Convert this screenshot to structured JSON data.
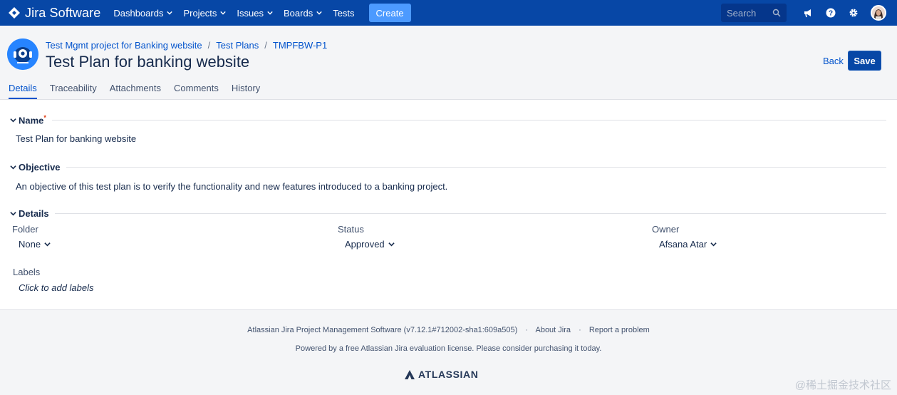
{
  "app": {
    "name": "Jira Software"
  },
  "nav": {
    "items": [
      {
        "label": "Dashboards",
        "has_menu": true
      },
      {
        "label": "Projects",
        "has_menu": true
      },
      {
        "label": "Issues",
        "has_menu": true
      },
      {
        "label": "Boards",
        "has_menu": true
      },
      {
        "label": "Tests",
        "has_menu": false
      }
    ],
    "create_label": "Create",
    "search_placeholder": "Search"
  },
  "header": {
    "breadcrumb": [
      "Test Mgmt project for Banking website",
      "Test Plans",
      "TMPFBW-P1"
    ],
    "title": "Test Plan for banking website",
    "back_label": "Back",
    "save_label": "Save"
  },
  "tabs": [
    {
      "label": "Details",
      "active": true
    },
    {
      "label": "Traceability",
      "active": false
    },
    {
      "label": "Attachments",
      "active": false
    },
    {
      "label": "Comments",
      "active": false
    },
    {
      "label": "History",
      "active": false
    }
  ],
  "sections": {
    "name": {
      "label": "Name",
      "required_mark": "*",
      "value": "Test Plan for banking website"
    },
    "objective": {
      "label": "Objective",
      "value": "An objective of this test plan is to verify the functionality and new features introduced to a banking project."
    },
    "details": {
      "label": "Details",
      "folder": {
        "label": "Folder",
        "value": "None"
      },
      "status": {
        "label": "Status",
        "value": "Approved"
      },
      "owner": {
        "label": "Owner",
        "value": "Afsana Atar"
      },
      "labels": {
        "label": "Labels",
        "placeholder": "Click to add labels"
      }
    }
  },
  "footer": {
    "version_text": "Atlassian Jira Project Management Software (v7.12.1#712002-sha1:609a505)",
    "about_label": "About Jira",
    "report_label": "Report a problem",
    "license_text": "Powered by a free Atlassian Jira evaluation license. Please consider purchasing it today.",
    "brand": "ATLASSIAN"
  },
  "watermark": "@稀土掘金技术社区",
  "colors": {
    "nav_bg": "#0747a6",
    "create_btn": "#4c9aff",
    "save_btn": "#0747a6",
    "link": "#0052cc"
  }
}
